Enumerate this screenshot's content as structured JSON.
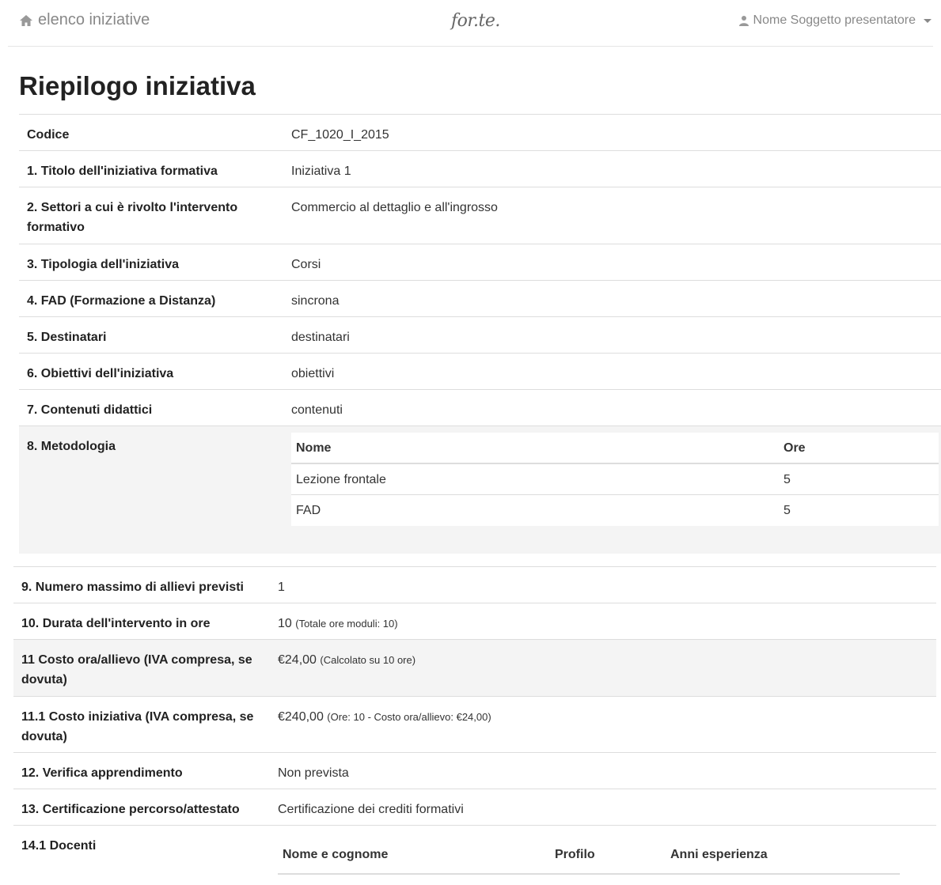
{
  "nav": {
    "back_label": "elenco iniziative",
    "logo_text": "for.te.",
    "user_label": "Nome Soggetto presentatore"
  },
  "page_title": "Riepilogo iniziativa",
  "rows": [
    {
      "label": "Codice",
      "value": "CF_1020_I_2015"
    },
    {
      "label": "1. Titolo dell'iniziativa formativa",
      "value": "Iniziativa 1"
    },
    {
      "label": "2. Settori a cui è rivolto l'intervento formativo",
      "value": "Commercio al dettaglio e all'ingrosso"
    },
    {
      "label": "3. Tipologia dell'iniziativa",
      "value": "Corsi"
    },
    {
      "label": "4. FAD (Formazione a Distanza)",
      "value": "sincrona"
    },
    {
      "label": "5. Destinatari",
      "value": "destinatari"
    },
    {
      "label": "6. Obiettivi dell'iniziativa",
      "value": "obiettivi"
    },
    {
      "label": "7. Contenuti didattici",
      "value": "contenuti"
    }
  ],
  "metodologia": {
    "label": "8. Metodologia",
    "headers": [
      "Nome",
      "Ore"
    ],
    "items": [
      {
        "nome": "Lezione frontale",
        "ore": "5"
      },
      {
        "nome": "FAD",
        "ore": "5"
      }
    ]
  },
  "rows2": [
    {
      "label": "9. Numero massimo di allievi previsti",
      "value": "1",
      "note": ""
    },
    {
      "label": "10. Durata dell'intervento in ore",
      "value": "10",
      "note": "(Totale ore moduli: 10)"
    },
    {
      "label": "11 Costo ora/allievo (IVA compresa, se dovuta)",
      "value": "€24,00",
      "note": "(Calcolato su 10 ore)"
    },
    {
      "label": "11.1 Costo iniziativa (IVA compresa, se dovuta)",
      "value": "€240,00",
      "note": "(Ore: 10 - Costo ora/allievo: €24,00)"
    },
    {
      "label": "12. Verifica apprendimento",
      "value": "Non prevista",
      "note": ""
    },
    {
      "label": "13. Certificazione percorso/attestato",
      "value": "Certificazione dei crediti formativi",
      "note": ""
    }
  ],
  "docenti": {
    "label": "14.1 Docenti",
    "headers": [
      "Nome e cognome",
      "Profilo",
      "Anni esperienza"
    ]
  },
  "colors": {
    "text": "#333333",
    "muted": "#888888",
    "border": "#dddddd",
    "stripe": "#f4f4f4"
  },
  "icons": [
    "home-icon",
    "user-icon",
    "caret-down-icon"
  ]
}
